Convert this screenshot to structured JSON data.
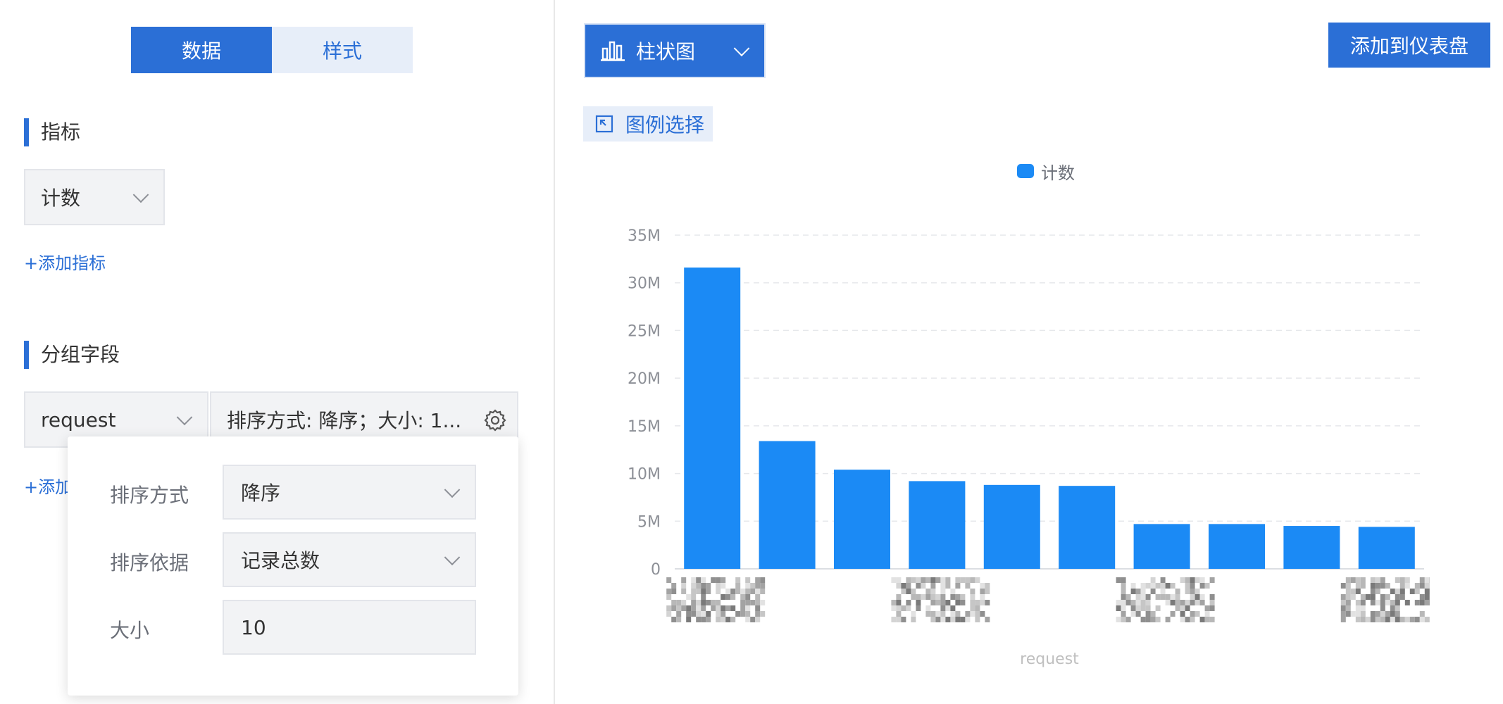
{
  "left_panel": {
    "tabs": [
      {
        "label": "数据",
        "active": true
      },
      {
        "label": "样式",
        "active": false
      }
    ],
    "metric": {
      "section_title": "指标",
      "selected": "计数",
      "add_link": "+添加指标"
    },
    "group": {
      "section_title": "分组字段",
      "field": "request",
      "sort_summary": "排序方式: 降序；大小: 1...",
      "add_link_partial": "+添加"
    },
    "popover": {
      "sort_order_label": "排序方式",
      "sort_order_value": "降序",
      "sort_by_label": "排序依据",
      "sort_by_value": "记录总数",
      "size_label": "大小",
      "size_value": "10"
    }
  },
  "right_panel": {
    "chart_type_label": "柱状图",
    "add_to_dashboard": "添加到仪表盘",
    "legend_select": "图例选择",
    "accent_color": "#2b6fd6",
    "bar_color": "#1b8af5"
  },
  "chart_data": {
    "type": "bar",
    "categories": [
      "",
      "",
      "",
      "",
      "",
      "",
      "",
      "",
      "",
      ""
    ],
    "series": [
      {
        "name": "计数",
        "values": [
          31.6,
          13.4,
          10.4,
          9.2,
          8.8,
          8.7,
          4.7,
          4.7,
          4.5,
          4.4
        ]
      }
    ],
    "unit": "M",
    "ylim": [
      0,
      35
    ],
    "yticks": [
      "0",
      "5M",
      "10M",
      "15M",
      "20M",
      "25M",
      "30M",
      "35M"
    ],
    "xlabel": "request",
    "ylabel": "",
    "grid": true,
    "legend_position": "top-center"
  }
}
